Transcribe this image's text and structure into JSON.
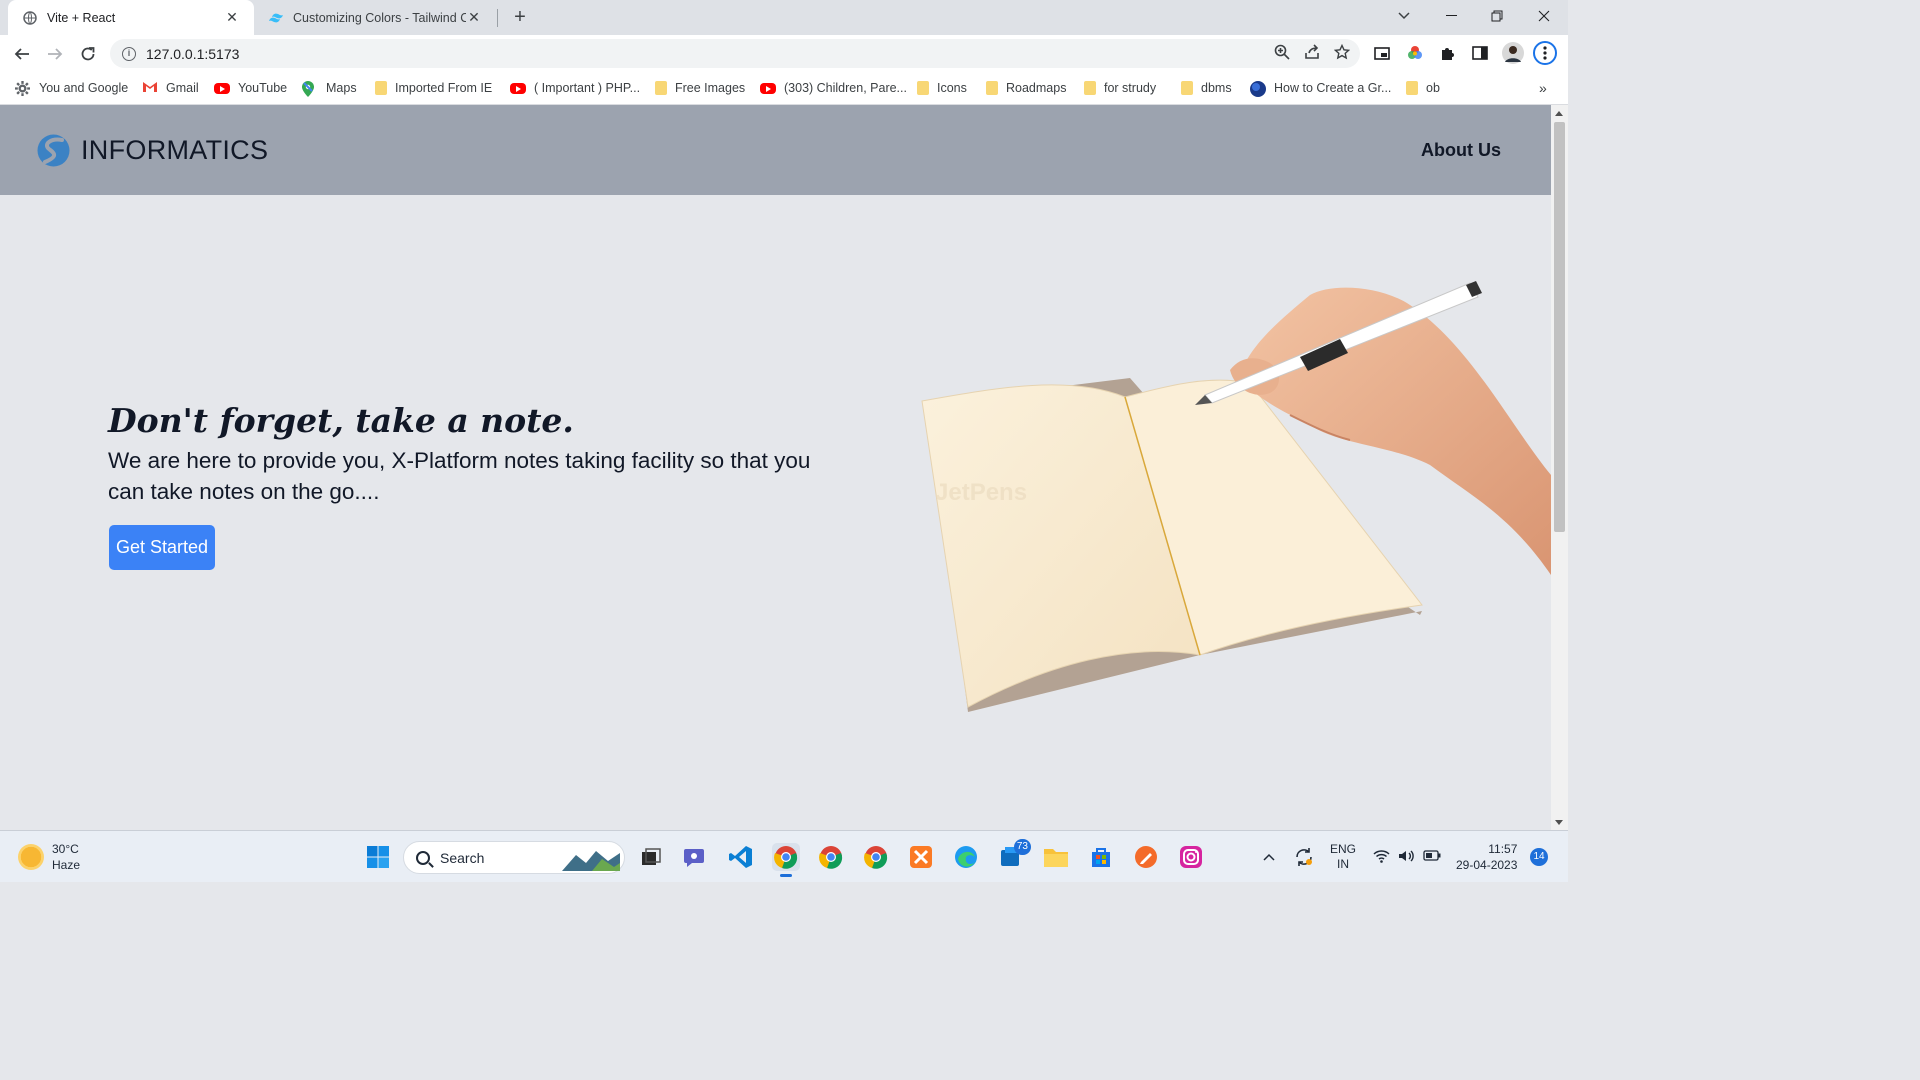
{
  "browser": {
    "tabs": [
      {
        "title": "Vite + React",
        "active": true
      },
      {
        "title": "Customizing Colors - Tailwind CSS",
        "active": false
      }
    ],
    "url": "127.0.0.1:5173",
    "bookmarks": [
      {
        "label": "You and Google",
        "icon": "gear-icon"
      },
      {
        "label": "Gmail",
        "icon": "gmail-icon"
      },
      {
        "label": "YouTube",
        "icon": "youtube-icon"
      },
      {
        "label": "Maps",
        "icon": "maps-icon"
      },
      {
        "label": "Imported From IE",
        "icon": "folder-icon"
      },
      {
        "label": "( Important ) PHP...",
        "icon": "youtube-icon"
      },
      {
        "label": "Free Images",
        "icon": "folder-icon"
      },
      {
        "label": "(303) Children, Pare...",
        "icon": "youtube-icon"
      },
      {
        "label": "Icons",
        "icon": "folder-icon"
      },
      {
        "label": "Roadmaps",
        "icon": "folder-icon"
      },
      {
        "label": "for strudy",
        "icon": "folder-icon"
      },
      {
        "label": "dbms",
        "icon": "folder-icon"
      },
      {
        "label": "How to Create a Gr...",
        "icon": "site-icon"
      },
      {
        "label": "ob",
        "icon": "folder-icon"
      }
    ],
    "more_bookmarks": "»"
  },
  "page": {
    "brand": "INFORMATICS",
    "nav_link": "About Us",
    "hero": {
      "title": "Don't forget, take a note.",
      "text": "We are here to provide you, X-Platform notes taking facility so that you can take notes on the go....",
      "cta": "Get Started"
    },
    "watermark": "JetPens"
  },
  "taskbar": {
    "weather": {
      "temp": "30°C",
      "condition": "Haze"
    },
    "search_placeholder": "Search",
    "teams_badge": "73",
    "language": {
      "line1": "ENG",
      "line2": "IN"
    },
    "time": "11:57",
    "date": "29-04-2023",
    "notifications": "14"
  },
  "colors": {
    "navbar": "#9ca3af",
    "page_bg": "#e5e7eb",
    "cta": "#3b82f6"
  }
}
